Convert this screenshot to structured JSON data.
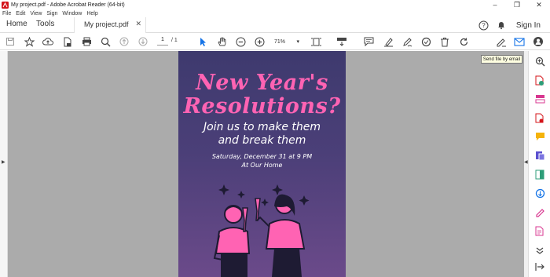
{
  "window": {
    "title": "My project.pdf - Adobe Acrobat Reader (64-bit)",
    "controls": [
      "minimize",
      "restore",
      "close"
    ]
  },
  "menu": [
    "File",
    "Edit",
    "View",
    "Sign",
    "Window",
    "Help"
  ],
  "tabs": {
    "home": "Home",
    "tools": "Tools",
    "document": "My project.pdf",
    "signin": "Sign In"
  },
  "toolbar": {
    "page_current": "1",
    "page_total": "/ 1",
    "zoom": "71%"
  },
  "tooltip": "Send file by email",
  "document": {
    "headline_line1": "New Year's",
    "headline_line2": "Resolutions?",
    "subtitle_line1": "Join us to make them",
    "subtitle_line2": "and break them",
    "date_line1": "Saturday, December 31 at 9 PM",
    "date_line2": "At Our Home"
  },
  "colors": {
    "accent_pink": "#ff63b3",
    "poster_bg": "#43396f",
    "cursor_blue": "#1473e6",
    "viewer_gray": "#ababab"
  }
}
